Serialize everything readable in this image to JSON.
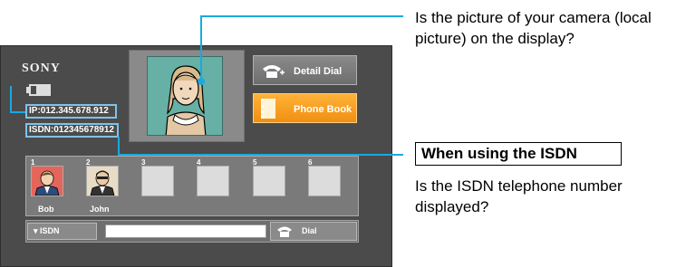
{
  "callouts": {
    "camera_question": "Is the picture of your camera (local picture) on the display?",
    "isdn_heading": "When using the ISDN",
    "isdn_question": "Is the ISDN telephone number displayed?"
  },
  "screen": {
    "brand": "SONY",
    "ip_address": "IP:012.345.678.912",
    "isdn_number": "ISDN:012345678912",
    "buttons": {
      "detail_dial": "Detail Dial",
      "phone_book": "Phone Book",
      "isdn_select": "ISDN",
      "dial": "Dial"
    },
    "contacts": [
      {
        "number": "1",
        "name": "Bob"
      },
      {
        "number": "2",
        "name": "John"
      },
      {
        "number": "3",
        "name": ""
      },
      {
        "number": "4",
        "name": ""
      },
      {
        "number": "5",
        "name": ""
      },
      {
        "number": "6",
        "name": ""
      }
    ],
    "dial_input_value": ""
  },
  "colors": {
    "screen_bg": "#4b4b4b",
    "highlight_box": "#7ec3ea",
    "phone_book_button": "#f5a023",
    "camera_bg": "#5fa99e"
  }
}
